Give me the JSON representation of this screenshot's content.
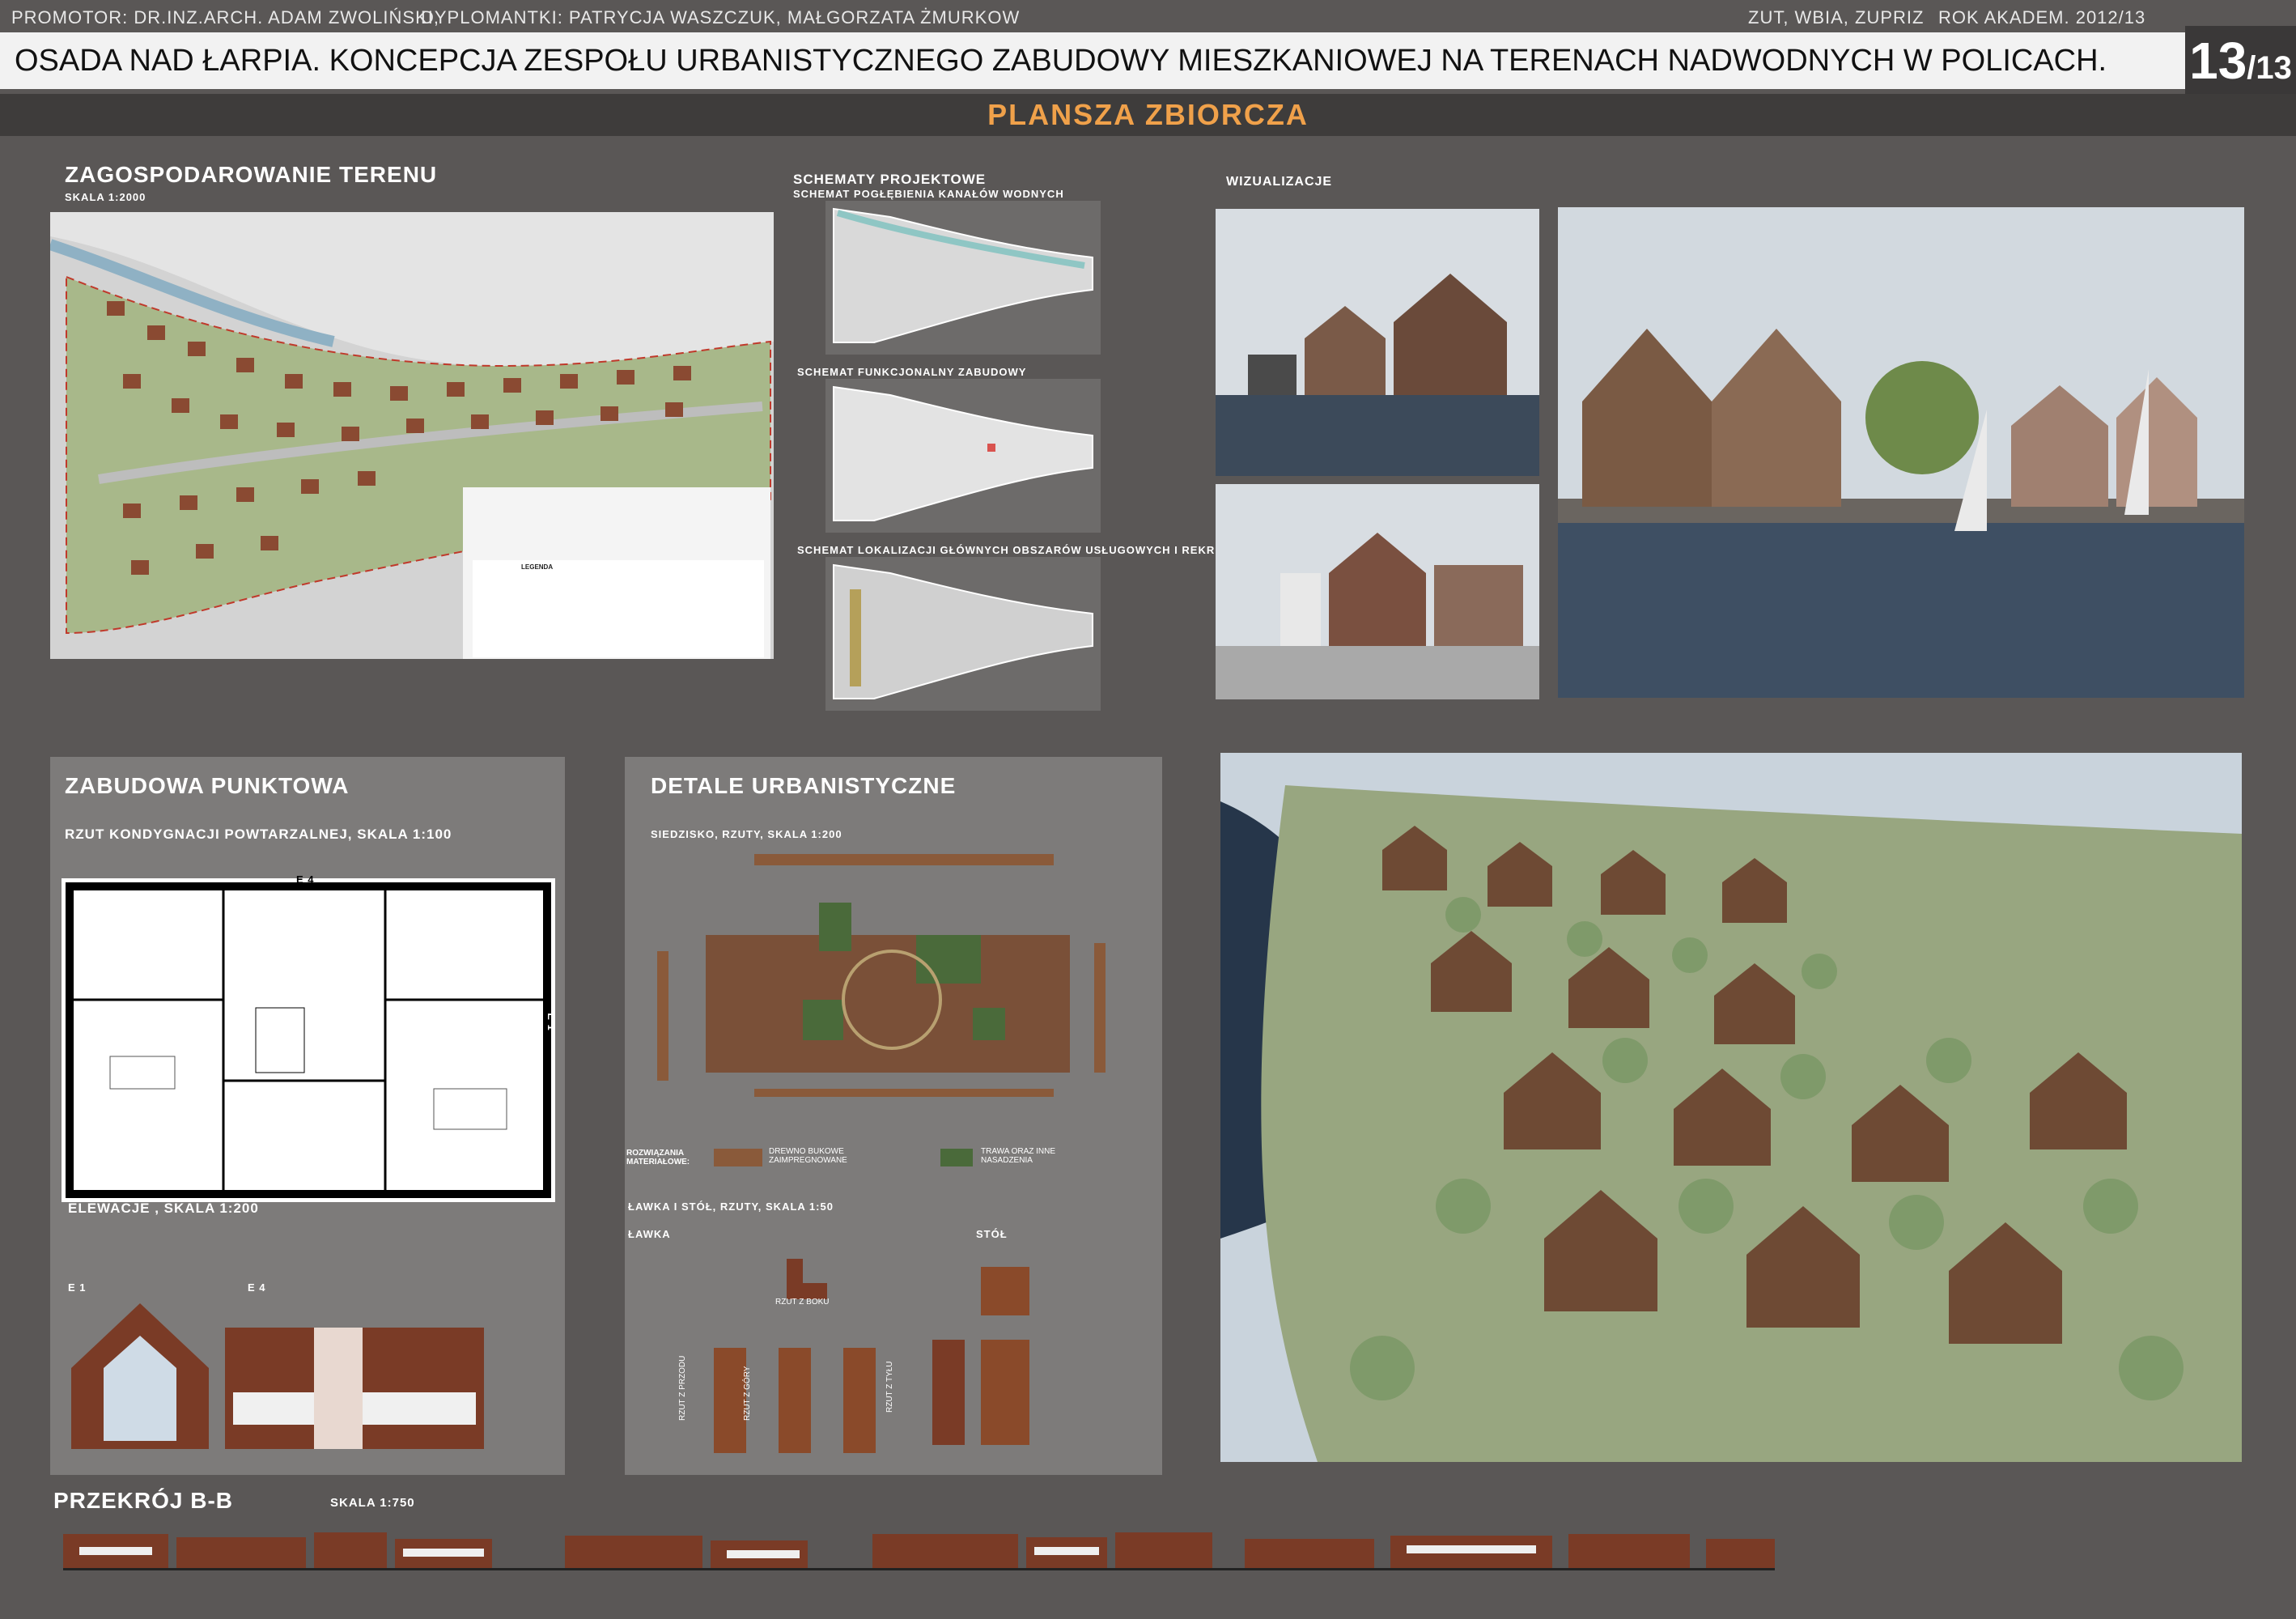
{
  "header": {
    "promotor": "PROMOTOR: DR.INZ.ARCH. ADAM ZWOLIŃSKI,",
    "dyplomantki": "DYPLOMANTKI: PATRYCJA WASZCZUK, MAŁGORZATA ŻMURKOW",
    "institution": "ZUT, WBIA, ZUPRIZ",
    "year": "ROK AKADEM. 2012/13",
    "title": "OSADA NAD ŁARPIA. KONCEPCJA ZESPOŁU URBANISTYCZNEGO ZABUDOWY MIESZKANIOWEJ NA TERENACH NADWODNYCH W POLICACH.",
    "page_num": "13",
    "page_total": "/13",
    "subtitle": "PLANSZA ZBIORCZA"
  },
  "site_plan": {
    "title": "ZAGOSPODAROWANIE TERENU",
    "scale": "SKALA 1:2000",
    "legend_title": "LEGENDA"
  },
  "schemes": {
    "title": "SCHEMATY PROJEKTOWE",
    "s1": "SCHEMAT POGŁĘBIENIA KANAŁÓW WODNYCH",
    "s2": "SCHEMAT FUNKCJONALNY ZABUDOWY",
    "s3": "SCHEMAT LOKALIZACJI GŁÓWNYCH OBSZARÓW USŁUGOWYCH I REKREACYJNYCH"
  },
  "visualizations": {
    "title": "WIZUALIZACJE"
  },
  "point_building": {
    "title": "ZABUDOWA PUNKTOWA",
    "floor_plan": "RZUT KONDYGNACJI POWTARZALNEJ, SKALA 1:100",
    "e4": "E 4",
    "e1_side": "E 1",
    "elevations": "ELEWACJE , SKALA 1:200",
    "elev_e1": "E 1",
    "elev_e4": "E 4"
  },
  "details": {
    "title": "DETALE URBANISTYCZNE",
    "seating": "SIEDZISKO, RZUTY, SKALA 1:200",
    "materials_label": "ROZWIĄZANIA MATERIAŁOWE:",
    "wood": "DREWNO BUKOWE ZAIMPREGNOWANE",
    "grass": "TRAWA ORAZ INNE NASADZENIA",
    "bench_table": "ŁAWKA I STÓŁ, RZUTY, SKALA 1:50",
    "bench": "ŁAWKA",
    "table": "STÓŁ",
    "side_view": "RZUT Z BOKU",
    "front_view": "RZUT Z PRZODU",
    "top_view": "RZUT Z GÓRY",
    "back_view": "RZUT Z TYŁU"
  },
  "section": {
    "title": "PRZEKRÓJ B-B",
    "scale": "SKALA 1:750"
  },
  "colors": {
    "background": "#5a5756",
    "title_orange": "#f0a14a",
    "panel": "#7d7b7a",
    "brick": "#7a3b26",
    "wood": "#8a5a3a",
    "water": "#2e3f55",
    "grass": "#6e8a4a"
  }
}
